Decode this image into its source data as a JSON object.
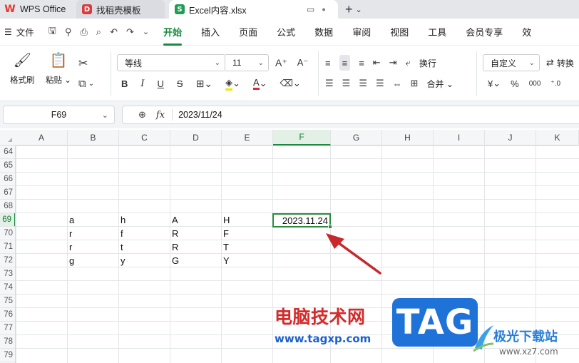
{
  "tabs": [
    {
      "label": "WPS Office",
      "icon": "wps-logo-icon"
    },
    {
      "label": "找稻壳模板",
      "icon": "docer-icon"
    },
    {
      "label": "Excel内容.xlsx",
      "icon": "spreadsheet-icon",
      "active": true
    }
  ],
  "menu": {
    "file_label": "文件",
    "items": [
      "开始",
      "插入",
      "页面",
      "公式",
      "数据",
      "审阅",
      "视图",
      "工具",
      "会员专享",
      "效"
    ],
    "active": "开始"
  },
  "toolbar": {
    "format_painter": "格式刷",
    "paste": "粘贴",
    "font_name": "等线",
    "font_size": "11",
    "wrap": "换行",
    "merge": "合并",
    "number_format": "自定义",
    "convert": "转换",
    "currency": "¥",
    "percent": "%",
    "thousands": "000",
    "bold": "B",
    "italic": "I",
    "underline": "U",
    "strike": "S",
    "font_color_letter": "A"
  },
  "formula_bar": {
    "name_box": "F69",
    "fx": "fx",
    "value": "2023/11/24"
  },
  "grid": {
    "columns": [
      "A",
      "B",
      "C",
      "D",
      "E",
      "F",
      "G",
      "H",
      "I",
      "J",
      "K"
    ],
    "selected_column": "F",
    "rows": [
      "64",
      "65",
      "66",
      "67",
      "68",
      "69",
      "70",
      "71",
      "72",
      "73",
      "74",
      "75",
      "76",
      "77",
      "78",
      "79"
    ],
    "selected_row": "69",
    "data": [
      {
        "row": "69",
        "B": "a",
        "C": "h",
        "D": "A",
        "E": "H",
        "F": "2023.11.24"
      },
      {
        "row": "70",
        "B": "r",
        "C": "f",
        "D": "R",
        "E": "F"
      },
      {
        "row": "71",
        "B": "r",
        "C": "t",
        "D": "R",
        "E": "T"
      },
      {
        "row": "72",
        "B": "g",
        "C": "y",
        "D": "G",
        "E": "Y"
      }
    ],
    "selected_cell_display": "2023.11.24"
  },
  "watermark": {
    "cn_text": "电脑技术网",
    "url": "www.tagxp.com",
    "tag": "TAG",
    "site_name": "极光下载站",
    "site_url": "www.xz7.com"
  },
  "colors": {
    "accent": "#1a8a3c",
    "annotation_arrow": "#c8282c",
    "watermark_red": "#d42a2a",
    "watermark_blue": "#1e72d8"
  }
}
